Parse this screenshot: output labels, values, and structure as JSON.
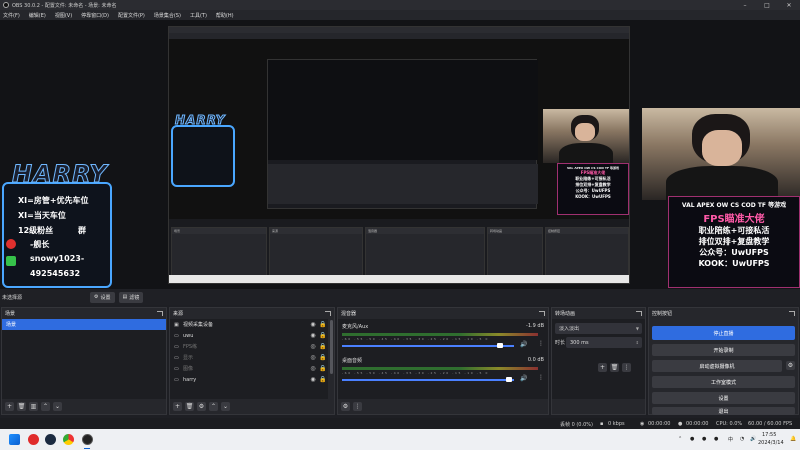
{
  "window": {
    "title": "OBS 30.0.2 - 配置文件: 未命名 - 场景: 未命名"
  },
  "menu": [
    "文件(F)",
    "编辑(E)",
    "视图(V)",
    "停靠窗口(D)",
    "配置文件(P)",
    "场景集合(S)",
    "工具(T)",
    "帮助(H)"
  ],
  "overlay": {
    "name": "HARRY",
    "lines": [
      "XI=房管+优先车位",
      "XI=当天车位",
      "12级粉丝",
      "群",
      "-舰长",
      "snowy1023-",
      "492545632"
    ]
  },
  "promo": {
    "games": "VAL APEX OW CS COD TF 等游戏",
    "line1": "FPS瞄准大佬",
    "line2": "职业陪练+可接私活",
    "line3": "排位双排+复盘教学",
    "wechat": "公众号：UwUFPS",
    "kook": "KOOK：UwUFPS"
  },
  "scenebar": {
    "label": "未选择源",
    "properties": "设置",
    "filters": "滤镜"
  },
  "docks": {
    "scenes": {
      "title": "场景",
      "items": [
        "场景"
      ]
    },
    "sources": {
      "title": "来源",
      "items": [
        {
          "name": "视频采集设备",
          "icon": "camera-icon",
          "dim": false
        },
        {
          "name": "uwu",
          "icon": "image-icon",
          "dim": false
        },
        {
          "name": "FPS练",
          "icon": "gamepad-icon",
          "dim": true
        },
        {
          "name": "显示",
          "icon": "monitor-icon",
          "dim": true
        },
        {
          "name": "图像",
          "icon": "image-icon",
          "dim": true
        },
        {
          "name": "harry",
          "icon": "image-icon",
          "dim": false
        }
      ]
    },
    "mixer": {
      "title": "混音器",
      "channels": [
        {
          "name": "麦克风/Aux",
          "db": "-1.9 dB",
          "level": 0.92
        },
        {
          "name": "桌面音频",
          "db": "0.0 dB",
          "level": 0.97
        }
      ],
      "ticks": "-60 -55 -50 -45 -40 -35 -30 -25 -20 -15 -10 -5 0"
    },
    "transitions": {
      "title": "转场动画",
      "type": "淡入淡出",
      "duration_label": "时长",
      "duration": "300 ms"
    },
    "controls": {
      "title": "控制按钮",
      "buttons": [
        "停止直播",
        "开始录制",
        "启动虚拟摄像机",
        "工作室模式",
        "设置",
        "退出"
      ]
    }
  },
  "status": {
    "dropped": "丢帧 0 (0.0%)",
    "bitrate": "0 kbps",
    "live": "00:00:00",
    "rec": "00:00:00",
    "cpu": "CPU: 0.0%",
    "fps": "60.00 / 60.00 FPS"
  },
  "taskbar": {
    "time": "17:55",
    "date": "2024/3/14"
  },
  "colors": {
    "accent": "#2f6ce0",
    "overlay_border": "#4aa7ff",
    "promo_pink": "#ff5aa8"
  }
}
